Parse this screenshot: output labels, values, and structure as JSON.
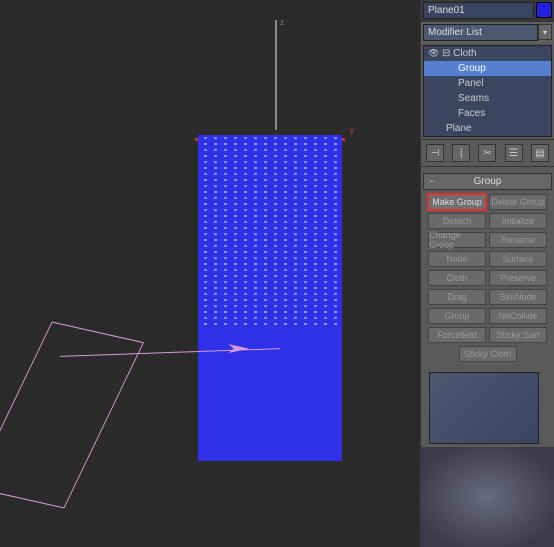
{
  "object_name": "Plane01",
  "modifier_dropdown": "Modifier List",
  "stack": {
    "root": "Cloth",
    "children": [
      "Group",
      "Panel",
      "Seams",
      "Faces"
    ],
    "base": "Plane",
    "selected": "Group"
  },
  "toolbar_icons": [
    "pin-icon",
    "bulb-icon",
    "scissors-icon",
    "config-icon",
    "trash-icon"
  ],
  "rollout": {
    "title": "Group",
    "buttons": [
      "Make Group",
      "Delete Group",
      "Detach",
      "Initialize",
      "Change Group",
      "Rename",
      "Node",
      "Surface",
      "Cloth",
      "Preserve",
      "Drag",
      "SimNode",
      "Group",
      "NoCollide",
      "Forcefield",
      "Sticky Surf",
      "Sticky Cloth"
    ],
    "highlighted": "Make Group"
  },
  "axis": {
    "y": "y"
  },
  "gizmo_label": "z"
}
